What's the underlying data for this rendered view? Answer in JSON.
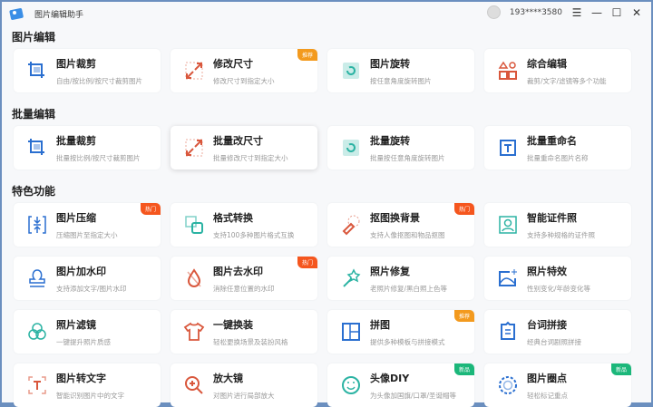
{
  "app": {
    "title": "图片编辑助手",
    "user": "193****3580"
  },
  "colors": {
    "recommend": "#f39a1e",
    "hot": "#f5561e",
    "new": "#1bb77a"
  },
  "sections": [
    {
      "title": "图片编辑",
      "cards": [
        {
          "title": "图片裁剪",
          "desc": "自由/按比例/按尺寸裁剪图片",
          "icon": "crop-icon",
          "color": "#2a6fd0"
        },
        {
          "title": "修改尺寸",
          "desc": "修改尺寸到指定大小",
          "icon": "resize-icon",
          "color": "#d9573c",
          "badge": "推荐",
          "badge_type": "recommend"
        },
        {
          "title": "图片旋转",
          "desc": "按任意角度旋转图片",
          "icon": "rotate-icon",
          "color": "#2bb3a3"
        },
        {
          "title": "综合编辑",
          "desc": "裁剪/文字/滤镜等多个功能",
          "icon": "shapes-icon",
          "color": "#d9573c"
        }
      ]
    },
    {
      "title": "批量编辑",
      "cards": [
        {
          "title": "批量裁剪",
          "desc": "批量按比例/按尺寸裁剪图片",
          "icon": "batch-crop-icon",
          "color": "#2a6fd0"
        },
        {
          "title": "批量改尺寸",
          "desc": "批量修改尺寸到指定大小",
          "icon": "batch-resize-icon",
          "color": "#d9573c",
          "active": true
        },
        {
          "title": "批量旋转",
          "desc": "批量按任意角度旋转图片",
          "icon": "batch-rotate-icon",
          "color": "#2bb3a3"
        },
        {
          "title": "批量重命名",
          "desc": "批量重命名图片名称",
          "icon": "rename-icon",
          "color": "#2a6fd0"
        }
      ]
    },
    {
      "title": "特色功能",
      "cards": [
        {
          "title": "图片压缩",
          "desc": "压缩图片至指定大小",
          "icon": "compress-icon",
          "color": "#2a6fd0",
          "badge": "热门",
          "badge_type": "hot"
        },
        {
          "title": "格式转换",
          "desc": "支持100多种图片格式互换",
          "icon": "convert-icon",
          "color": "#2bb3a3"
        },
        {
          "title": "抠图换背景",
          "desc": "支持人像抠图和物品抠图",
          "icon": "cutout-icon",
          "color": "#d9573c",
          "badge": "热门",
          "badge_type": "hot"
        },
        {
          "title": "智能证件照",
          "desc": "支持多种规格的证件照",
          "icon": "id-photo-icon",
          "color": "#2bb3a3"
        },
        {
          "title": "图片加水印",
          "desc": "支持添加文字/图片水印",
          "icon": "stamp-icon",
          "color": "#2a6fd0"
        },
        {
          "title": "图片去水印",
          "desc": "消除任意位置的水印",
          "icon": "remove-watermark-icon",
          "color": "#d9573c",
          "badge": "热门",
          "badge_type": "hot"
        },
        {
          "title": "照片修复",
          "desc": "老照片修复/黑白照上色等",
          "icon": "magic-wand-icon",
          "color": "#2bb3a3"
        },
        {
          "title": "照片特效",
          "desc": "性别变化/年龄变化等",
          "icon": "effect-icon",
          "color": "#2a6fd0"
        },
        {
          "title": "照片滤镜",
          "desc": "一键提升照片质感",
          "icon": "filter-icon",
          "color": "#2bb3a3"
        },
        {
          "title": "一键换装",
          "desc": "轻松更换场景及装扮风格",
          "icon": "shirt-icon",
          "color": "#d9573c"
        },
        {
          "title": "拼图",
          "desc": "提供多种模板与拼接模式",
          "icon": "collage-icon",
          "color": "#2a6fd0",
          "badge": "推荐",
          "badge_type": "recommend"
        },
        {
          "title": "台词拼接",
          "desc": "经典台词剧照拼接",
          "icon": "subtitle-icon",
          "color": "#2a6fd0"
        },
        {
          "title": "图片转文字",
          "desc": "智能识别图片中的文字",
          "icon": "ocr-icon",
          "color": "#d9573c"
        },
        {
          "title": "放大镜",
          "desc": "对图片进行局部放大",
          "icon": "magnifier-icon",
          "color": "#d9573c"
        },
        {
          "title": "头像DIY",
          "desc": "为头像加国旗/口罩/圣诞帽等",
          "icon": "smile-icon",
          "color": "#2bb3a3",
          "badge": "新品",
          "badge_type": "new"
        },
        {
          "title": "图片圈点",
          "desc": "轻松标记重点",
          "icon": "circle-mark-icon",
          "color": "#2a6fd0",
          "badge": "新品",
          "badge_type": "new"
        }
      ]
    }
  ]
}
